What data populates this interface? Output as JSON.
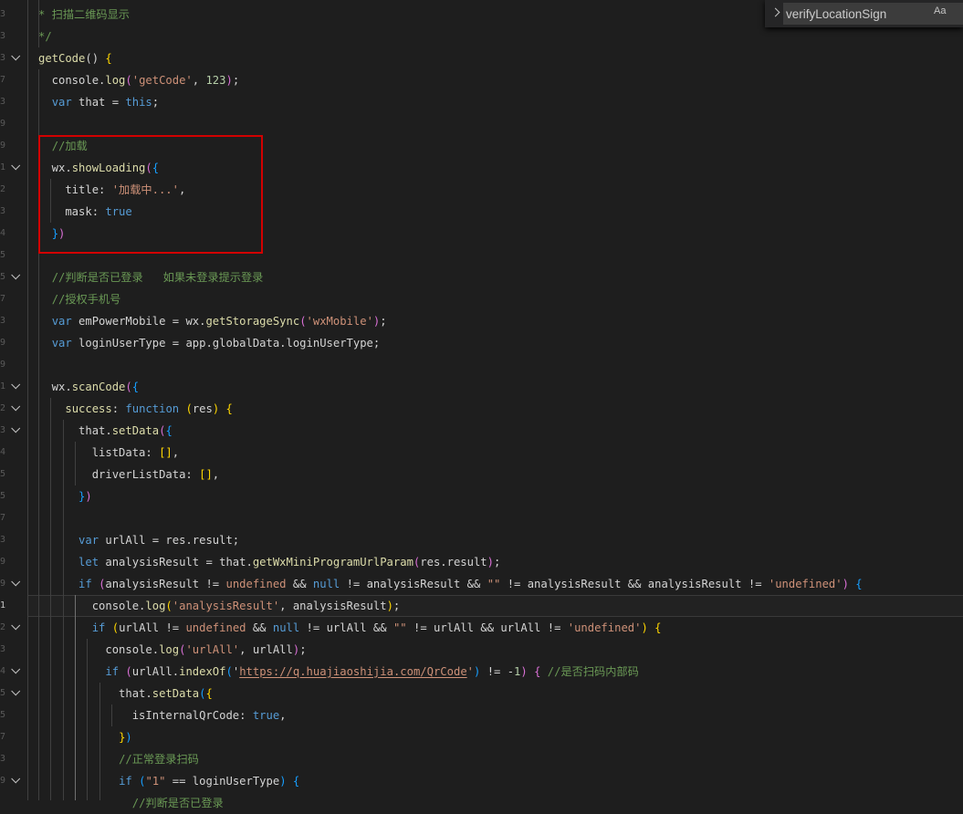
{
  "editor": {
    "active_line_number": "1",
    "find": {
      "query": "verifyLocationSign",
      "match_case_label": "Aa"
    },
    "lines": {
      "l01": [
        {
          "t": "* 扫描二维码显示",
          "c": "c"
        }
      ],
      "l02": [
        {
          "t": "*/",
          "c": "c"
        }
      ],
      "l03": [
        {
          "t": "getCode",
          "c": "f"
        },
        {
          "t": "() "
        },
        {
          "t": "{",
          "c": "y"
        }
      ],
      "l04": [
        {
          "t": "  console."
        },
        {
          "t": "log",
          "c": "f"
        },
        {
          "t": "(",
          "c": "p"
        },
        {
          "t": "'getCode'",
          "c": "s"
        },
        {
          "t": ", "
        },
        {
          "t": "123",
          "c": "n"
        },
        {
          "t": ")",
          "c": "p"
        },
        {
          "t": ";"
        }
      ],
      "l05": [
        {
          "t": "  "
        },
        {
          "t": "var",
          "c": "k"
        },
        {
          "t": " that = "
        },
        {
          "t": "this",
          "c": "k"
        },
        {
          "t": ";"
        }
      ],
      "l06": [
        {
          "t": "  "
        },
        {
          "t": "//加载",
          "c": "c"
        }
      ],
      "l07": [
        {
          "t": "  wx."
        },
        {
          "t": "showLoading",
          "c": "f"
        },
        {
          "t": "(",
          "c": "p"
        },
        {
          "t": "{",
          "c": "b"
        }
      ],
      "l08": [
        {
          "t": "    title: "
        },
        {
          "t": "'加载中...'",
          "c": "s"
        },
        {
          "t": ","
        }
      ],
      "l09": [
        {
          "t": "    mask: "
        },
        {
          "t": "true",
          "c": "k"
        }
      ],
      "l10": [
        {
          "t": "  "
        },
        {
          "t": "}",
          "c": "b"
        },
        {
          "t": ")",
          "c": "p"
        }
      ],
      "l11": [
        {
          "t": "  "
        },
        {
          "t": "//判断是否已登录   如果未登录提示登录",
          "c": "c"
        }
      ],
      "l12": [
        {
          "t": "  "
        },
        {
          "t": "//授权手机号",
          "c": "c"
        }
      ],
      "l13": [
        {
          "t": "  "
        },
        {
          "t": "var",
          "c": "k"
        },
        {
          "t": " emPowerMobile = wx."
        },
        {
          "t": "getStorageSync",
          "c": "f"
        },
        {
          "t": "(",
          "c": "p"
        },
        {
          "t": "'wxMobile'",
          "c": "s"
        },
        {
          "t": ")",
          "c": "p"
        },
        {
          "t": ";"
        }
      ],
      "l14": [
        {
          "t": "  "
        },
        {
          "t": "var",
          "c": "k"
        },
        {
          "t": " loginUserType = app.globalData.loginUserType;"
        }
      ],
      "l15": [
        {
          "t": "  wx."
        },
        {
          "t": "scanCode",
          "c": "f"
        },
        {
          "t": "(",
          "c": "p"
        },
        {
          "t": "{",
          "c": "b"
        }
      ],
      "l16": [
        {
          "t": "    "
        },
        {
          "t": "success",
          "c": "f"
        },
        {
          "t": ": "
        },
        {
          "t": "function",
          "c": "k"
        },
        {
          "t": " "
        },
        {
          "t": "(",
          "c": "y"
        },
        {
          "t": "res"
        },
        {
          "t": ")",
          "c": "y"
        },
        {
          "t": " "
        },
        {
          "t": "{",
          "c": "y"
        }
      ],
      "l17": [
        {
          "t": "      that."
        },
        {
          "t": "setData",
          "c": "f"
        },
        {
          "t": "(",
          "c": "p"
        },
        {
          "t": "{",
          "c": "b"
        }
      ],
      "l18": [
        {
          "t": "        listData: "
        },
        {
          "t": "[]",
          "c": "y"
        },
        {
          "t": ","
        }
      ],
      "l19": [
        {
          "t": "        driverListData: "
        },
        {
          "t": "[]",
          "c": "y"
        },
        {
          "t": ","
        }
      ],
      "l20": [
        {
          "t": "      "
        },
        {
          "t": "}",
          "c": "b"
        },
        {
          "t": ")",
          "c": "p"
        }
      ],
      "l21": [
        {
          "t": "      "
        },
        {
          "t": "var",
          "c": "k"
        },
        {
          "t": " urlAll = res.result;"
        }
      ],
      "l22": [
        {
          "t": "      "
        },
        {
          "t": "let",
          "c": "k"
        },
        {
          "t": " analysisResult = that."
        },
        {
          "t": "getWxMiniProgramUrlParam",
          "c": "f"
        },
        {
          "t": "(",
          "c": "p"
        },
        {
          "t": "res.result"
        },
        {
          "t": ")",
          "c": "p"
        },
        {
          "t": ";"
        }
      ],
      "l23": [
        {
          "t": "      "
        },
        {
          "t": "if",
          "c": "k"
        },
        {
          "t": " "
        },
        {
          "t": "(",
          "c": "p"
        },
        {
          "t": "analysisResult != "
        },
        {
          "t": "undefined",
          "c": "s"
        },
        {
          "t": " && "
        },
        {
          "t": "null",
          "c": "k"
        },
        {
          "t": " != analysisResult && "
        },
        {
          "t": "\"\"",
          "c": "s"
        },
        {
          "t": " != analysisResult && analysisResult != "
        },
        {
          "t": "'undefined'",
          "c": "s"
        },
        {
          "t": ")",
          "c": "p"
        },
        {
          "t": " "
        },
        {
          "t": "{",
          "c": "b"
        }
      ],
      "l24": [
        {
          "t": "        console."
        },
        {
          "t": "log",
          "c": "f"
        },
        {
          "t": "(",
          "c": "y"
        },
        {
          "t": "'analysisResult'",
          "c": "s"
        },
        {
          "t": ", analysisResult"
        },
        {
          "t": ")",
          "c": "y"
        },
        {
          "t": ";"
        }
      ],
      "l25": [
        {
          "t": "        "
        },
        {
          "t": "if",
          "c": "k"
        },
        {
          "t": " "
        },
        {
          "t": "(",
          "c": "y"
        },
        {
          "t": "urlAll != "
        },
        {
          "t": "undefined",
          "c": "s"
        },
        {
          "t": " && "
        },
        {
          "t": "null",
          "c": "k"
        },
        {
          "t": " != urlAll && "
        },
        {
          "t": "\"\"",
          "c": "s"
        },
        {
          "t": " != urlAll && urlAll != "
        },
        {
          "t": "'undefined'",
          "c": "s"
        },
        {
          "t": ")",
          "c": "y"
        },
        {
          "t": " "
        },
        {
          "t": "{",
          "c": "y"
        }
      ],
      "l26": [
        {
          "t": "          console."
        },
        {
          "t": "log",
          "c": "f"
        },
        {
          "t": "(",
          "c": "p"
        },
        {
          "t": "'urlAll'",
          "c": "s"
        },
        {
          "t": ", urlAll"
        },
        {
          "t": ")",
          "c": "p"
        },
        {
          "t": ";"
        }
      ],
      "l27": [
        {
          "t": "          "
        },
        {
          "t": "if",
          "c": "k"
        },
        {
          "t": " "
        },
        {
          "t": "(",
          "c": "p"
        },
        {
          "t": "urlAll."
        },
        {
          "t": "indexOf",
          "c": "f"
        },
        {
          "t": "(",
          "c": "b"
        },
        {
          "t": "'"
        },
        {
          "t": "https://q.huajiaoshijia.com/QrCode",
          "c": "s u"
        },
        {
          "t": "'",
          "c": "s"
        },
        {
          "t": ")",
          "c": "b"
        },
        {
          "t": " != -"
        },
        {
          "t": "1",
          "c": "n"
        },
        {
          "t": ")",
          "c": "p"
        },
        {
          "t": " "
        },
        {
          "t": "{",
          "c": "p"
        },
        {
          "t": " "
        },
        {
          "t": "//是否扫码内部码",
          "c": "c"
        }
      ],
      "l28": [
        {
          "t": "            that."
        },
        {
          "t": "setData",
          "c": "f"
        },
        {
          "t": "(",
          "c": "b"
        },
        {
          "t": "{",
          "c": "y"
        }
      ],
      "l29": [
        {
          "t": "              isInternalQrCode: "
        },
        {
          "t": "true",
          "c": "k"
        },
        {
          "t": ","
        }
      ],
      "l30": [
        {
          "t": "            "
        },
        {
          "t": "}",
          "c": "y"
        },
        {
          "t": ")",
          "c": "b"
        }
      ],
      "l31": [
        {
          "t": "            "
        },
        {
          "t": "//正常登录扫码",
          "c": "c"
        }
      ],
      "l32": [
        {
          "t": "            "
        },
        {
          "t": "if",
          "c": "k"
        },
        {
          "t": " "
        },
        {
          "t": "(",
          "c": "b"
        },
        {
          "t": "\"1\"",
          "c": "s"
        },
        {
          "t": " == loginUserType"
        },
        {
          "t": ")",
          "c": "b"
        },
        {
          "t": " "
        },
        {
          "t": "{",
          "c": "b"
        }
      ],
      "l33": [
        {
          "t": "              "
        },
        {
          "t": "//判断是否已登录",
          "c": "c"
        }
      ]
    }
  }
}
